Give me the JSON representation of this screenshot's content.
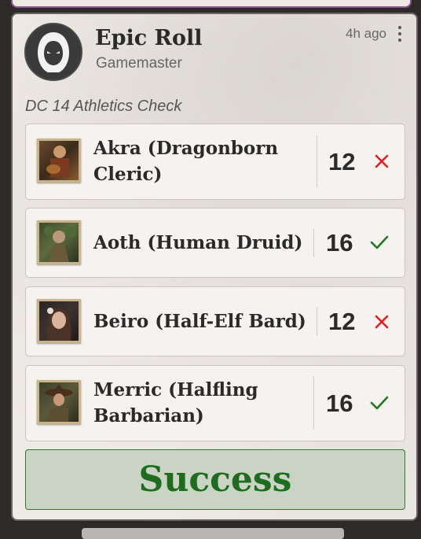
{
  "header": {
    "title": "Epic Roll",
    "subtitle": "Gamemaster",
    "time": "4h ago"
  },
  "check_title": "DC 14 Athletics Check",
  "rows": [
    {
      "name_line1": "Akra (Dragonborn",
      "name_line2": "Cleric)",
      "score": "12",
      "status": "fail"
    },
    {
      "name_line1": "Aoth (Human Druid)",
      "name_line2": "",
      "score": "16",
      "status": "pass"
    },
    {
      "name_line1": "Beiro (Half-Elf Bard)",
      "name_line2": "",
      "score": "12",
      "status": "fail"
    },
    {
      "name_line1": "Merric (Halfling",
      "name_line2": "Barbarian)",
      "score": "16",
      "status": "pass"
    }
  ],
  "result": "Success",
  "colors": {
    "pass": "#1f7a1f",
    "fail": "#e02020",
    "result_text": "#1f6b1f"
  }
}
